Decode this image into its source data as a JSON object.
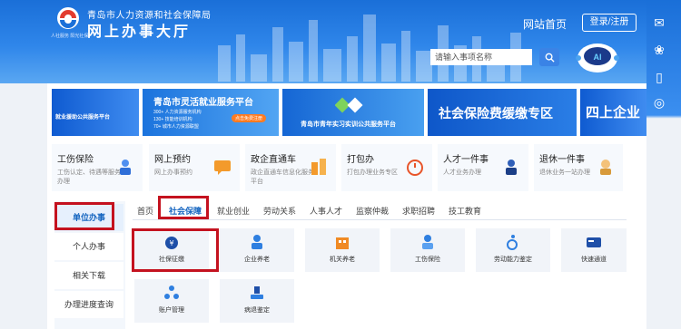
{
  "header": {
    "logo_text": "人社服务 阳光社保",
    "org_name": "青岛市人力资源和社会保障局",
    "hall_name": "网上办事大厅",
    "home_link": "网站首页",
    "login_label": "登录/注册",
    "search": {
      "placeholder": "请输入事项名称"
    },
    "robot_label": "AI"
  },
  "banners": [
    {
      "title": "就业援助公共服务平台",
      "partial": true
    },
    {
      "title": "青岛市灵活就业服务平台",
      "lines": [
        "300+ 人力资源服务机构",
        "130+ 技能培训机构",
        "70+ 城市人力资源联盟"
      ],
      "pill": "点击免费注册"
    },
    {
      "title": "青岛市青年实习实训公共服务平台"
    },
    {
      "title": "社会保险费缓缴专区"
    },
    {
      "title": "四上企业"
    }
  ],
  "cards": [
    {
      "title": "工伤保险",
      "desc": "工伤认定、待遇等服务办理"
    },
    {
      "title": "网上预约",
      "desc": "网上办事预约"
    },
    {
      "title": "政企直通车",
      "desc": "政企直通车信息化服务平台"
    },
    {
      "title": "打包办",
      "desc": "打包办理业务专区"
    },
    {
      "title": "人才一件事",
      "desc": "人才业务办理"
    },
    {
      "title": "退休一件事",
      "desc": "退休业务一站办理"
    }
  ],
  "left_nav": [
    "单位办事",
    "个人办事",
    "相关下载",
    "办理进度查询"
  ],
  "tabs": [
    "首页",
    "社会保障",
    "就业创业",
    "劳动关系",
    "人事人才",
    "监察仲裁",
    "求职招聘",
    "技工教育"
  ],
  "services": [
    "社保征缴",
    "企业养老",
    "机关养老",
    "工伤保险",
    "劳动能力鉴定",
    "快速通道",
    "账户管理",
    "病退鉴定"
  ],
  "colors": {
    "header": "#1a6fd8",
    "accent": "#1565c0",
    "highlight": "#c4121f"
  }
}
